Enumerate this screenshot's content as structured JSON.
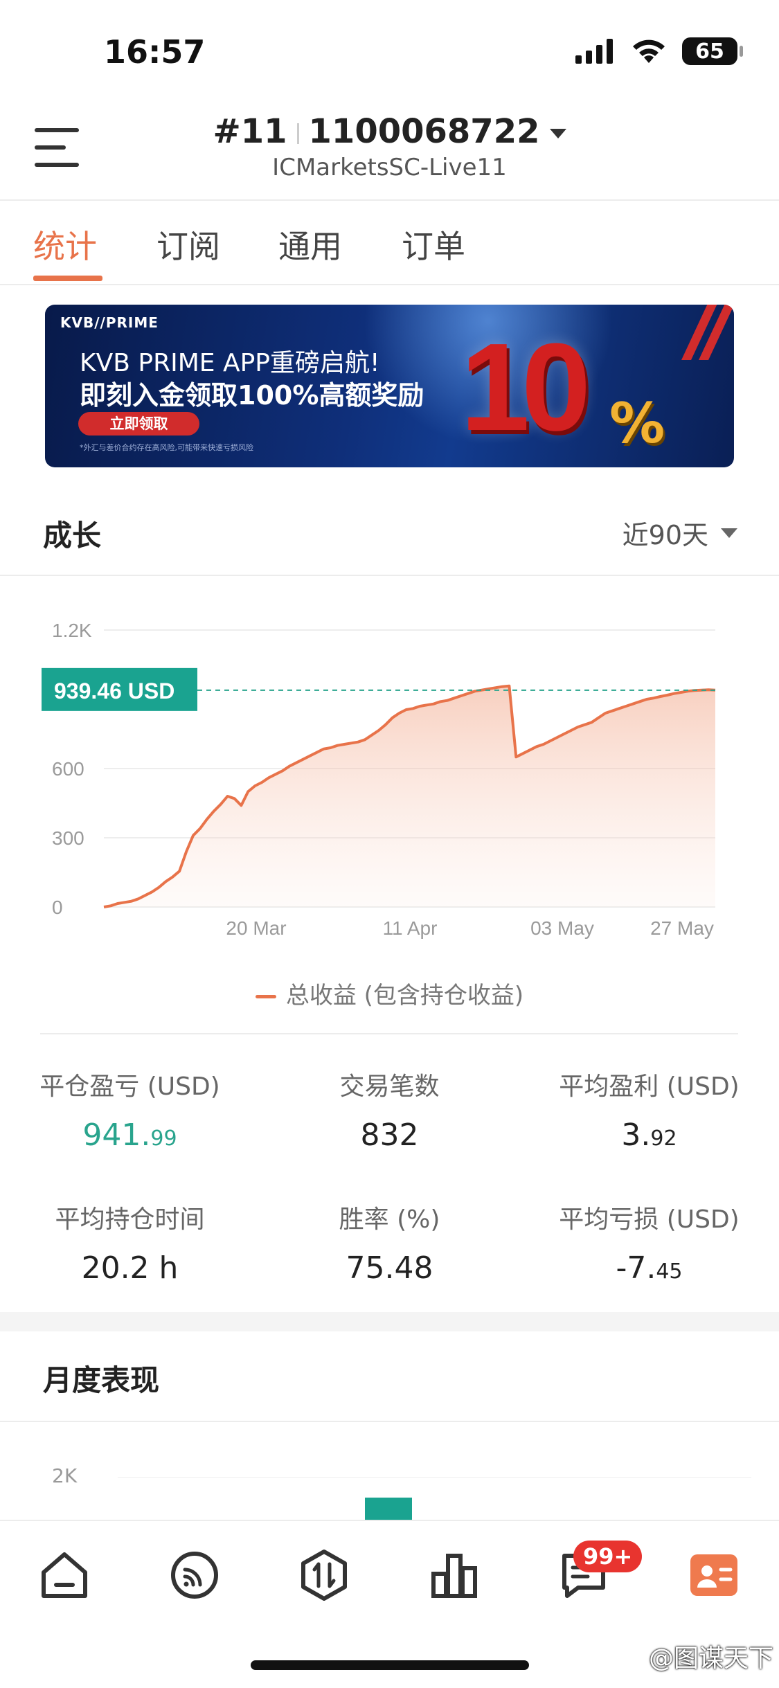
{
  "status_bar": {
    "time": "16:57",
    "battery": "65"
  },
  "header": {
    "account_index": "#11",
    "account_number": "1100068722",
    "server": "ICMarketsSC-Live11"
  },
  "tabs": [
    {
      "label": "统计",
      "active": true
    },
    {
      "label": "订阅",
      "active": false
    },
    {
      "label": "通用",
      "active": false
    },
    {
      "label": "订单",
      "active": false
    }
  ],
  "banner": {
    "logo": "KVB//PRIME",
    "line1": "KVB PRIME APP重磅启航!",
    "line2": "即刻入金领取100%高额奖励",
    "cta": "立即领取",
    "disclaimer": "*外汇与差价合约存在高风险,可能带来快速亏损风险",
    "big_number": "10",
    "percent": "%"
  },
  "growth": {
    "title": "成长",
    "period": "近90天",
    "legend": "总收益 (包含持仓收益)",
    "current_label": "939.46 USD"
  },
  "chart_data": {
    "type": "area",
    "y_ticks": [
      "1.2K",
      "600",
      "300",
      "0"
    ],
    "x_ticks": [
      "20 Mar",
      "11 Apr",
      "03 May",
      "27 May"
    ],
    "ylim": [
      0,
      1200
    ],
    "reference_value": 939.46,
    "reference_label": "939.46 USD",
    "color": "#e8734a",
    "series": [
      {
        "name": "总收益 (包含持仓收益)",
        "x": [
          0,
          1,
          2,
          3,
          4,
          5,
          6,
          7,
          8,
          9,
          10,
          11,
          12,
          13,
          14,
          15,
          16,
          17,
          18,
          19,
          20,
          21,
          22,
          23,
          24,
          25,
          26,
          27,
          28,
          29,
          30,
          31,
          32,
          33,
          34,
          35,
          36,
          37,
          38,
          39,
          40,
          41,
          42,
          43,
          44,
          45,
          46,
          47,
          48,
          49,
          50,
          51,
          52,
          53,
          54,
          55,
          56,
          57,
          58,
          59,
          60,
          61,
          62,
          63,
          64,
          65,
          66,
          67,
          68,
          69,
          70,
          71,
          72,
          73,
          74,
          75,
          76,
          77,
          78,
          79,
          80,
          81,
          82,
          83,
          84,
          85,
          86,
          87,
          88,
          89
        ],
        "values": [
          0,
          5,
          15,
          20,
          25,
          35,
          50,
          65,
          85,
          110,
          130,
          155,
          240,
          310,
          340,
          380,
          415,
          445,
          480,
          470,
          440,
          500,
          525,
          540,
          560,
          575,
          590,
          610,
          625,
          640,
          655,
          670,
          685,
          690,
          700,
          705,
          710,
          715,
          725,
          745,
          765,
          790,
          820,
          840,
          855,
          860,
          870,
          875,
          880,
          890,
          895,
          905,
          915,
          925,
          935,
          940,
          945,
          950,
          955,
          958,
          650,
          665,
          680,
          695,
          705,
          720,
          735,
          750,
          765,
          780,
          790,
          800,
          820,
          840,
          850,
          860,
          870,
          880,
          890,
          900,
          905,
          912,
          918,
          925,
          930,
          935,
          938,
          940,
          941,
          939.46
        ]
      }
    ]
  },
  "stats": [
    {
      "label": "平仓盈亏 (USD)",
      "int": "941.",
      "dec": "99",
      "color": "#29a48d"
    },
    {
      "label": "交易笔数",
      "int": "832",
      "dec": ""
    },
    {
      "label": "平均盈利 (USD)",
      "int": "3.",
      "dec": "92"
    },
    {
      "label": "平均持仓时间",
      "int": "20.2 h",
      "dec": ""
    },
    {
      "label": "胜率 (%)",
      "int": "75.48",
      "dec": ""
    },
    {
      "label": "平均亏损 (USD)",
      "int": "-7.",
      "dec": "45"
    }
  ],
  "monthly": {
    "title": "月度表现",
    "y_tick": "2K",
    "bar_color": "#1aa390"
  },
  "bottom_nav": {
    "items": [
      "home-icon",
      "feed-icon",
      "trade-icon",
      "chart-icon",
      "message-icon",
      "profile-icon"
    ],
    "badge": "99+"
  },
  "watermark": "@图谋天下",
  "colors": {
    "accent": "#e8734a",
    "positive": "#29a48d"
  }
}
